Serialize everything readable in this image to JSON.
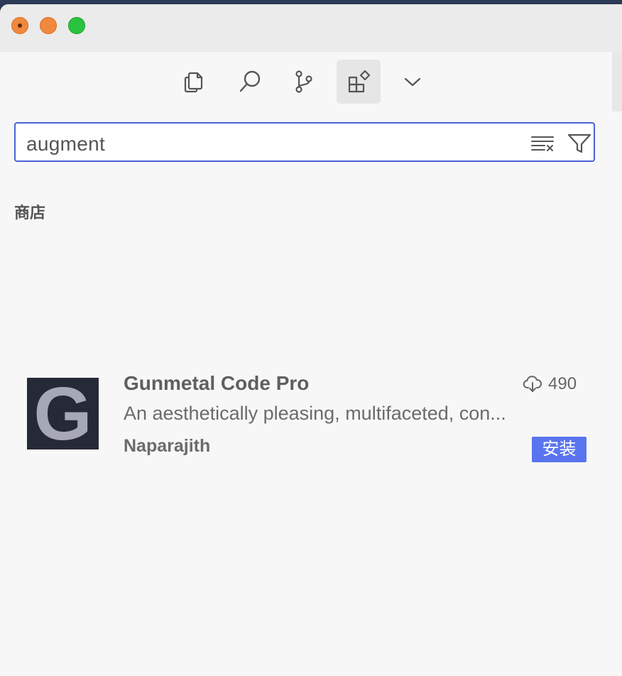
{
  "window": {
    "traffic_lights": [
      "close",
      "minimize",
      "maximize"
    ]
  },
  "activity_bar": {
    "items": [
      {
        "icon": "files-icon",
        "active": false
      },
      {
        "icon": "search-icon",
        "active": false
      },
      {
        "icon": "source-control-icon",
        "active": false
      },
      {
        "icon": "extensions-icon",
        "active": true
      },
      {
        "icon": "chevron-down-icon",
        "active": false
      }
    ]
  },
  "search": {
    "value": "augment",
    "clear_icon": "clear-results-icon",
    "filter_icon": "filter-icon"
  },
  "marketplace": {
    "section_title": "商店",
    "extensions": [
      {
        "logo_letter": "G",
        "name": "Gunmetal Code Pro",
        "description": "An aesthetically pleasing, multifaceted, con...",
        "author": "Naparajith",
        "downloads": "490",
        "install_label": "安装"
      }
    ]
  },
  "colors": {
    "accent": "#5a74f0",
    "search_border": "#4a63d6",
    "close_light": "#f0883e",
    "max_light": "#2ac33f"
  }
}
